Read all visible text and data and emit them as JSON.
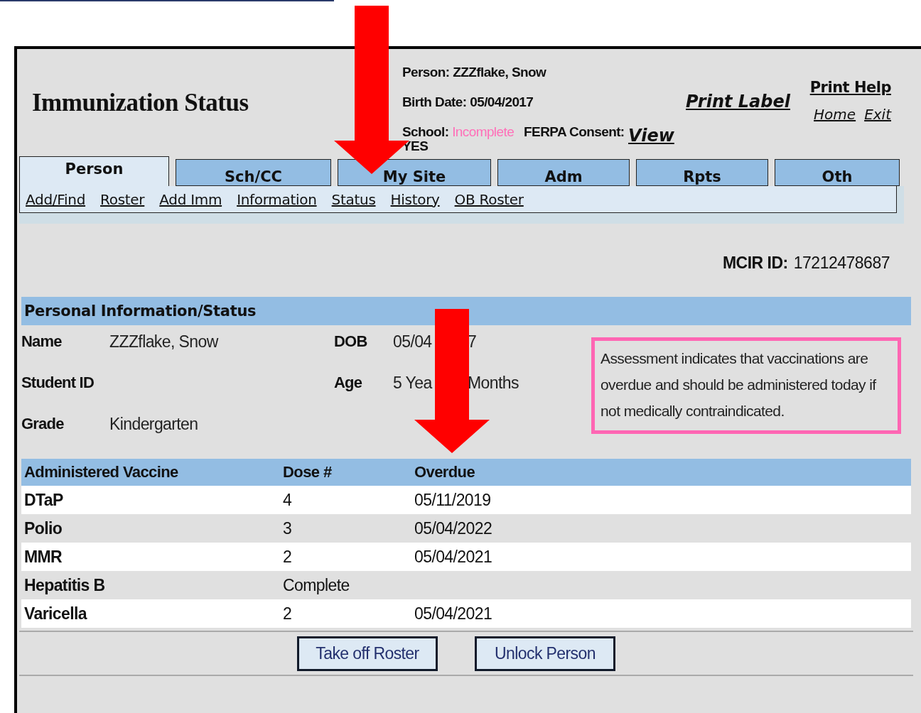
{
  "header": {
    "title": "Immunization Status",
    "person": "Person: ZZZflake, Snow",
    "birth": "Birth Date: 05/04/2017",
    "school_label": "School:",
    "school_status": "Incomplete",
    "ferpa_label": "FERPA Consent:",
    "ferpa_value": "YES",
    "print_label": "Print Label",
    "view": "View",
    "print_help": "Print Help",
    "home": "Home",
    "exit": "Exit"
  },
  "tabs": [
    {
      "label": "Person",
      "selected": true
    },
    {
      "label": "Sch/CC",
      "selected": false
    },
    {
      "label": "My Site",
      "selected": false
    },
    {
      "label": "Adm",
      "selected": false
    },
    {
      "label": "Rpts",
      "selected": false
    },
    {
      "label": "Oth",
      "selected": false
    }
  ],
  "subnav": [
    "Add/Find",
    "Roster",
    "Add Imm",
    "Information",
    "Status",
    "History",
    "OB Roster"
  ],
  "mcir": {
    "label": "MCIR ID:",
    "value": "17212478687"
  },
  "section": {
    "title": "Personal Information/Status",
    "left_fields": [
      {
        "label": "Name",
        "value": "ZZZflake, Snow"
      },
      {
        "label": "Student ID"
      },
      {
        "label": "Grade",
        "value": "Kindergarten"
      }
    ],
    "right_fields": [
      {
        "label": "DOB",
        "value_parts": [
          "05/04",
          "7"
        ]
      },
      {
        "label": "Age",
        "value_parts": [
          "5 Yea",
          "Months"
        ]
      }
    ],
    "notice": "Assessment indicates that vaccinations are overdue and should be administered today if not medically contraindicated."
  },
  "table": {
    "columns": [
      "Administered Vaccine",
      "Dose #",
      "Overdue"
    ],
    "rows": [
      [
        "DTaP",
        "4",
        "05/11/2019"
      ],
      [
        "Polio",
        "3",
        "05/04/2022"
      ],
      [
        "MMR",
        "2",
        "05/04/2021"
      ],
      [
        "Hepatitis B",
        "Complete",
        ""
      ],
      [
        "Varicella",
        "2",
        "05/04/2021"
      ]
    ]
  },
  "buttons": [
    "Take off Roster",
    "Unlock Person"
  ]
}
